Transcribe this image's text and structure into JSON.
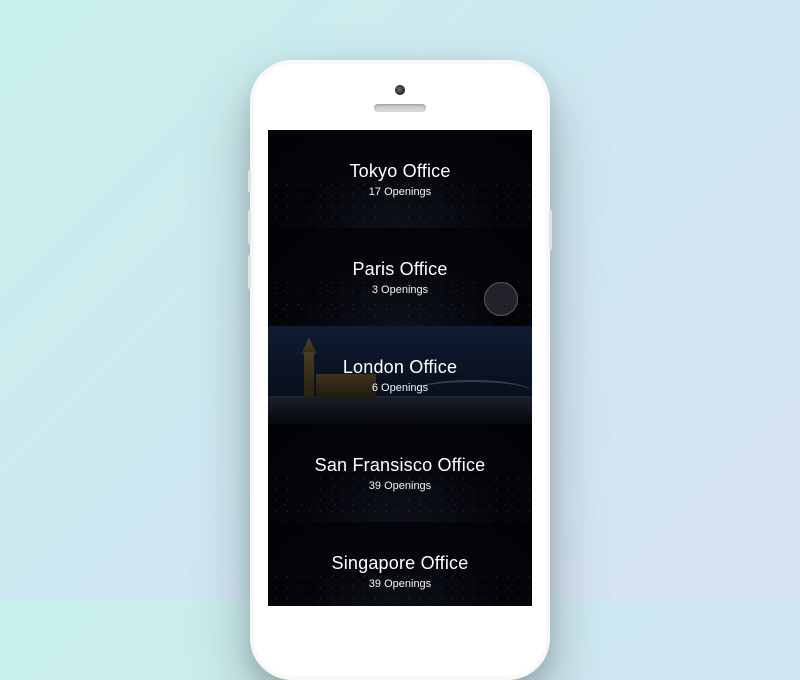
{
  "offices": [
    {
      "title": "Tokyo Office",
      "openings": "17 Openings",
      "highlight": false
    },
    {
      "title": "Paris Office",
      "openings": "3 Openings",
      "highlight": false
    },
    {
      "title": "London Office",
      "openings": "6 Openings",
      "highlight": true
    },
    {
      "title": "San Fransisco Office",
      "openings": "39 Openings",
      "highlight": false
    },
    {
      "title": "Singapore Office",
      "openings": "39 Openings",
      "highlight": false
    }
  ]
}
